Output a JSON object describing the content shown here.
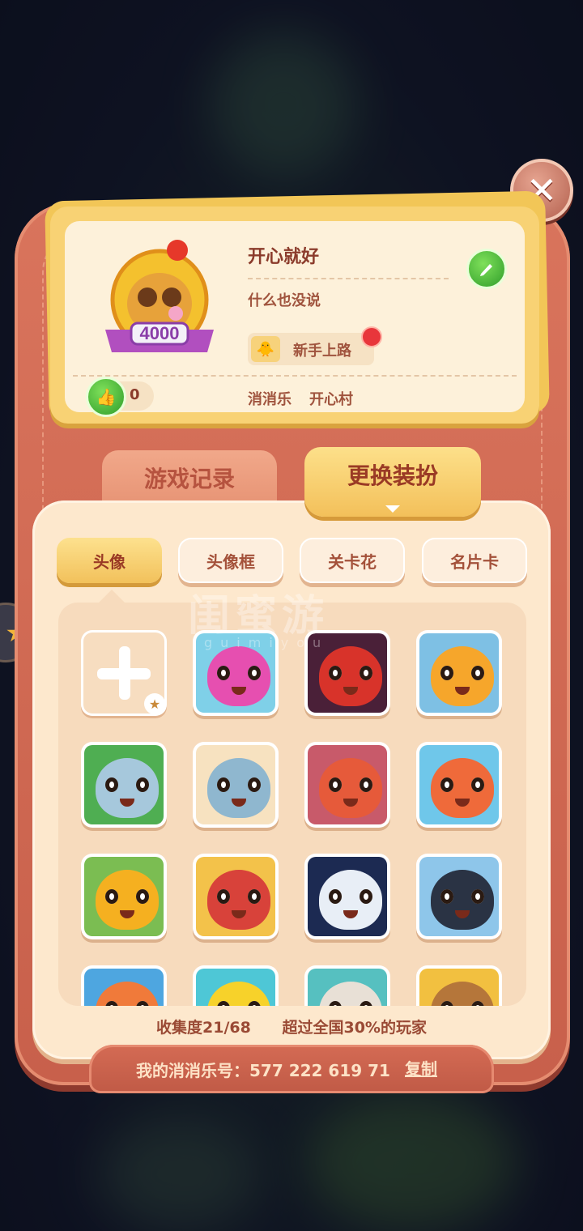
{
  "close_label": "✕",
  "profile": {
    "nickname": "开心就好",
    "signature": "什么也没说",
    "avatar_level": "4000",
    "badge_label": "新手上路",
    "like_count": "0",
    "game_name": "消消乐",
    "village": "开心村"
  },
  "tabs": {
    "records": "游戏记录",
    "dress": "更换装扮"
  },
  "sub_tabs": [
    "头像",
    "头像框",
    "关卡花",
    "名片卡"
  ],
  "watermark": {
    "main": "闺蜜游",
    "sub": "guimiyou"
  },
  "avatars": [
    {
      "name": "add-slot"
    },
    {
      "name": "pink-octopus",
      "color": "#e64fb0",
      "bg": "#7fd0e8"
    },
    {
      "name": "red-devil",
      "color": "#d8332a",
      "bg": "#4a2038"
    },
    {
      "name": "sunflower",
      "color": "#f6a62b",
      "bg": "#7ec0e4"
    },
    {
      "name": "blue-owl",
      "color": "#a6c8dc",
      "bg": "#4fae52"
    },
    {
      "name": "sushi-fluff",
      "color": "#8fb7cf",
      "bg": "#f7e2c0"
    },
    {
      "name": "crab-shell",
      "color": "#e65a3a",
      "bg": "#c85a6a"
    },
    {
      "name": "puffer-fish",
      "color": "#ef6a3a",
      "bg": "#6fc7ea"
    },
    {
      "name": "yellow-cyclops",
      "color": "#f5b020",
      "bg": "#7bbd52"
    },
    {
      "name": "squid-pirate",
      "color": "#d8423a",
      "bg": "#f3c24a"
    },
    {
      "name": "ghost",
      "color": "#e8eef6",
      "bg": "#1c2a52"
    },
    {
      "name": "penguin",
      "color": "#2a3344",
      "bg": "#8ec6ea"
    },
    {
      "name": "clownfish",
      "color": "#f07a3a",
      "bg": "#4ea6e0"
    },
    {
      "name": "yellow-chick",
      "color": "#f7d22a",
      "bg": "#4ec7d6"
    },
    {
      "name": "cow",
      "color": "#e8e0d6",
      "bg": "#56c0c0"
    },
    {
      "name": "monkey",
      "color": "#b5763a",
      "bg": "#f2c040"
    }
  ],
  "stats": {
    "collection": "收集度21/68",
    "rank": "超过全国30%的玩家"
  },
  "account": {
    "id_text": "我的消消乐号：577 222 619 71",
    "copy_label": "复制"
  },
  "colors": {
    "accent": "#f2c15b",
    "case": "#c8604b",
    "panel": "#fde8cd",
    "text": "#9a3a25"
  }
}
